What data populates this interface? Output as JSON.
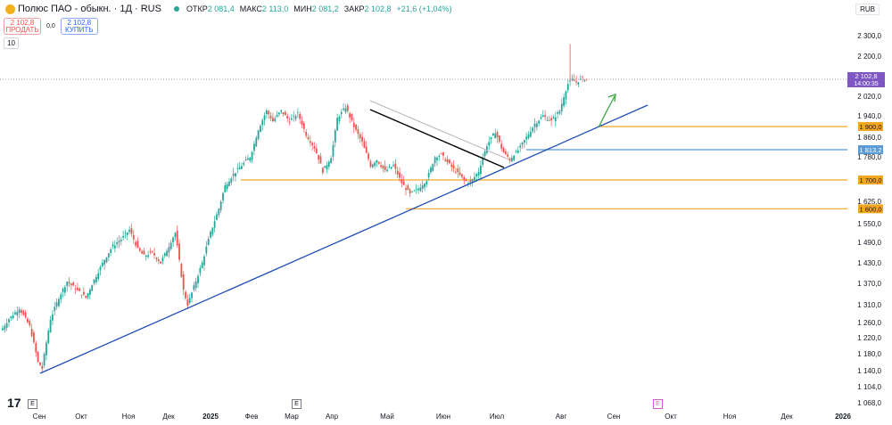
{
  "header": {
    "title": "Полюс ПАО - обыкн. · 1Д · RUS",
    "open_label": "ОТКР",
    "open_value": "2 081,4",
    "high_label": "МАКС",
    "high_value": "2 113,0",
    "low_label": "МИН",
    "low_value": "2 081,2",
    "close_label": "ЗАКР",
    "close_value": "2 102,8",
    "change": "+21,6 (+1,04%)",
    "currency": "RUB"
  },
  "trade": {
    "sell_price": "2 102,8",
    "sell_label": "ПРОДАТЬ",
    "spread": "0,0",
    "buy_price": "2 102,8",
    "buy_label": "КУПИТЬ",
    "interval": "10"
  },
  "colors": {
    "up": "#26a69a",
    "down": "#ef5350",
    "trend": "#1e4db7",
    "level": "#f5a623",
    "level_blue": "#5b9bd5",
    "arrow": "#3aa641",
    "last": "#7e57c2"
  },
  "chart_data": {
    "type": "candlestick",
    "ylim": [
      1040,
      2330
    ],
    "x_axis_labels": [
      "Сен",
      "Окт",
      "Ноя",
      "Дек",
      "2025",
      "Фев",
      "Мар",
      "Апр",
      "Май",
      "Июн",
      "Июл",
      "Авг",
      "Сен",
      "Окт",
      "Ноя",
      "Дек",
      "2026"
    ],
    "y_axis_labels": [
      "2 300,0",
      "2 200,0",
      "2 020,0",
      "1 940,0",
      "1 860,0",
      "1 780,0",
      "1 625,0",
      "1 550,0",
      "1 490,0",
      "1 430,0",
      "1 370,0",
      "1 310,0",
      "1 260,0",
      "1 220,0",
      "1 180,0",
      "1 140,0",
      "1 104,0",
      "1 068,0"
    ],
    "last_price": "2 102,8",
    "countdown": "14:00:35",
    "levels": [
      {
        "label": "1 900,0",
        "value": 1900,
        "color": "#f5a623"
      },
      {
        "label": "1 813,2",
        "value": 1813.2,
        "color": "#5b9bd5"
      },
      {
        "label": "1 700,0",
        "value": 1700,
        "color": "#f5a623"
      },
      {
        "label": "1 600,0",
        "value": 1600,
        "color": "#f5a623"
      }
    ],
    "anchors": [
      [
        0,
        1245
      ],
      [
        3,
        1270
      ],
      [
        8,
        1300
      ],
      [
        13,
        1250
      ],
      [
        17,
        1160
      ],
      [
        19,
        1145
      ],
      [
        23,
        1270
      ],
      [
        27,
        1330
      ],
      [
        31,
        1375
      ],
      [
        36,
        1350
      ],
      [
        40,
        1330
      ],
      [
        44,
        1380
      ],
      [
        49,
        1440
      ],
      [
        53,
        1480
      ],
      [
        57,
        1500
      ],
      [
        61,
        1530
      ],
      [
        65,
        1470
      ],
      [
        68,
        1450
      ],
      [
        72,
        1460
      ],
      [
        76,
        1430
      ],
      [
        80,
        1480
      ],
      [
        83,
        1520
      ],
      [
        87,
        1350
      ],
      [
        89,
        1310
      ],
      [
        92,
        1360
      ],
      [
        96,
        1430
      ],
      [
        100,
        1520
      ],
      [
        104,
        1600
      ],
      [
        107,
        1680
      ],
      [
        111,
        1720
      ],
      [
        115,
        1750
      ],
      [
        119,
        1780
      ],
      [
        123,
        1890
      ],
      [
        127,
        1960
      ],
      [
        130,
        1920
      ],
      [
        134,
        1960
      ],
      [
        138,
        1920
      ],
      [
        142,
        1950
      ],
      [
        146,
        1870
      ],
      [
        150,
        1820
      ],
      [
        154,
        1730
      ],
      [
        158,
        1780
      ],
      [
        161,
        1930
      ],
      [
        165,
        1975
      ],
      [
        169,
        1900
      ],
      [
        173,
        1840
      ],
      [
        177,
        1750
      ],
      [
        180,
        1770
      ],
      [
        184,
        1730
      ],
      [
        188,
        1750
      ],
      [
        192,
        1690
      ],
      [
        196,
        1650
      ],
      [
        200,
        1670
      ],
      [
        204,
        1700
      ],
      [
        208,
        1780
      ],
      [
        211,
        1790
      ],
      [
        214,
        1760
      ],
      [
        218,
        1730
      ],
      [
        222,
        1700
      ],
      [
        225,
        1690
      ],
      [
        229,
        1730
      ],
      [
        233,
        1830
      ],
      [
        237,
        1880
      ],
      [
        241,
        1800
      ],
      [
        244,
        1770
      ],
      [
        248,
        1810
      ],
      [
        252,
        1860
      ],
      [
        256,
        1910
      ],
      [
        260,
        1940
      ],
      [
        264,
        1920
      ],
      [
        268,
        1960
      ],
      [
        272,
        2080
      ],
      [
        274,
        2100
      ],
      [
        276,
        2090
      ],
      [
        279,
        2105
      ],
      [
        281,
        2102.8
      ]
    ]
  }
}
